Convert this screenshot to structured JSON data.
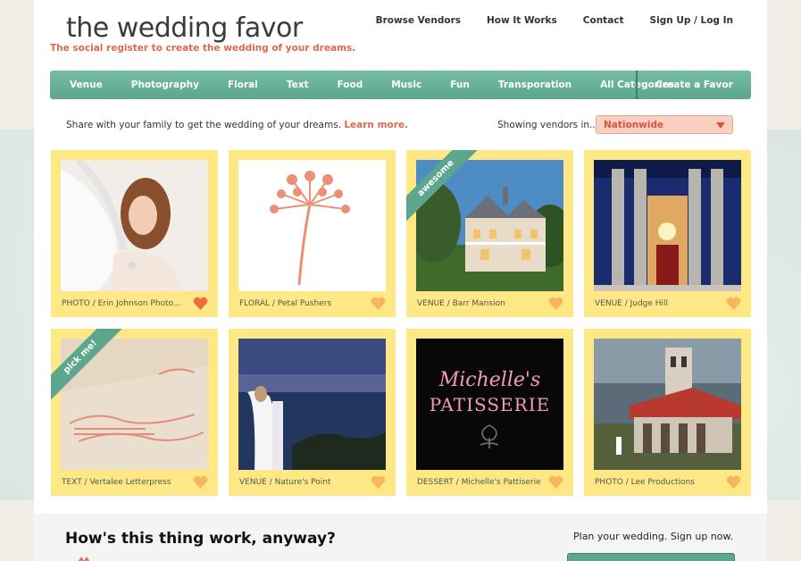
{
  "brand": {
    "logo": "the wedding favor",
    "tagline": "The social register to create the wedding of your dreams."
  },
  "topnav": [
    "Browse Vendors",
    "How It Works",
    "Contact",
    "Sign Up / Log In"
  ],
  "categories": [
    "Venue",
    "Photography",
    "Floral",
    "Text",
    "Food",
    "Music",
    "Fun",
    "Transporation",
    "All Categories"
  ],
  "create_favor": "Create a Favor",
  "share": {
    "text": "Share with your family to get the wedding of your dreams.",
    "learn_more": "Learn more.",
    "showing": "Showing vendors in...",
    "location": "Nationwide"
  },
  "cards": [
    {
      "caption": "PHOTO / Erin Johnson Photo...",
      "ribbon": "",
      "heart_active": true
    },
    {
      "caption": "FLORAL / Petal Pushers",
      "ribbon": "",
      "heart_active": false
    },
    {
      "caption": "VENUE / Barr Mansion",
      "ribbon": "awesome",
      "heart_active": false
    },
    {
      "caption": "VENUE / Judge Hill",
      "ribbon": "",
      "heart_active": false
    },
    {
      "caption": "TEXT / Vertalee Letterpress",
      "ribbon": "pick me!",
      "heart_active": false
    },
    {
      "caption": "VENUE / Nature's Point",
      "ribbon": "",
      "heart_active": false
    },
    {
      "caption": "DESSERT / Michelle's Pattiserie",
      "ribbon": "",
      "heart_active": false
    },
    {
      "caption": "PHOTO / Lee Productions",
      "ribbon": "",
      "heart_active": false
    }
  ],
  "patisserie": {
    "line1": "Michelle's",
    "line2": "PATISSERIE"
  },
  "how": {
    "title": "How's this thing work, anyway?",
    "plan": "Plan your wedding. Sign up now."
  },
  "colors": {
    "accent": "#e0674e",
    "nav_green": "#5ba68d",
    "card_yellow": "#fde885",
    "heart_active": "#f26b3a",
    "heart_inactive": "#f7b65c"
  },
  "icons": [
    "heart-icon",
    "dropdown-arrow-icon"
  ]
}
